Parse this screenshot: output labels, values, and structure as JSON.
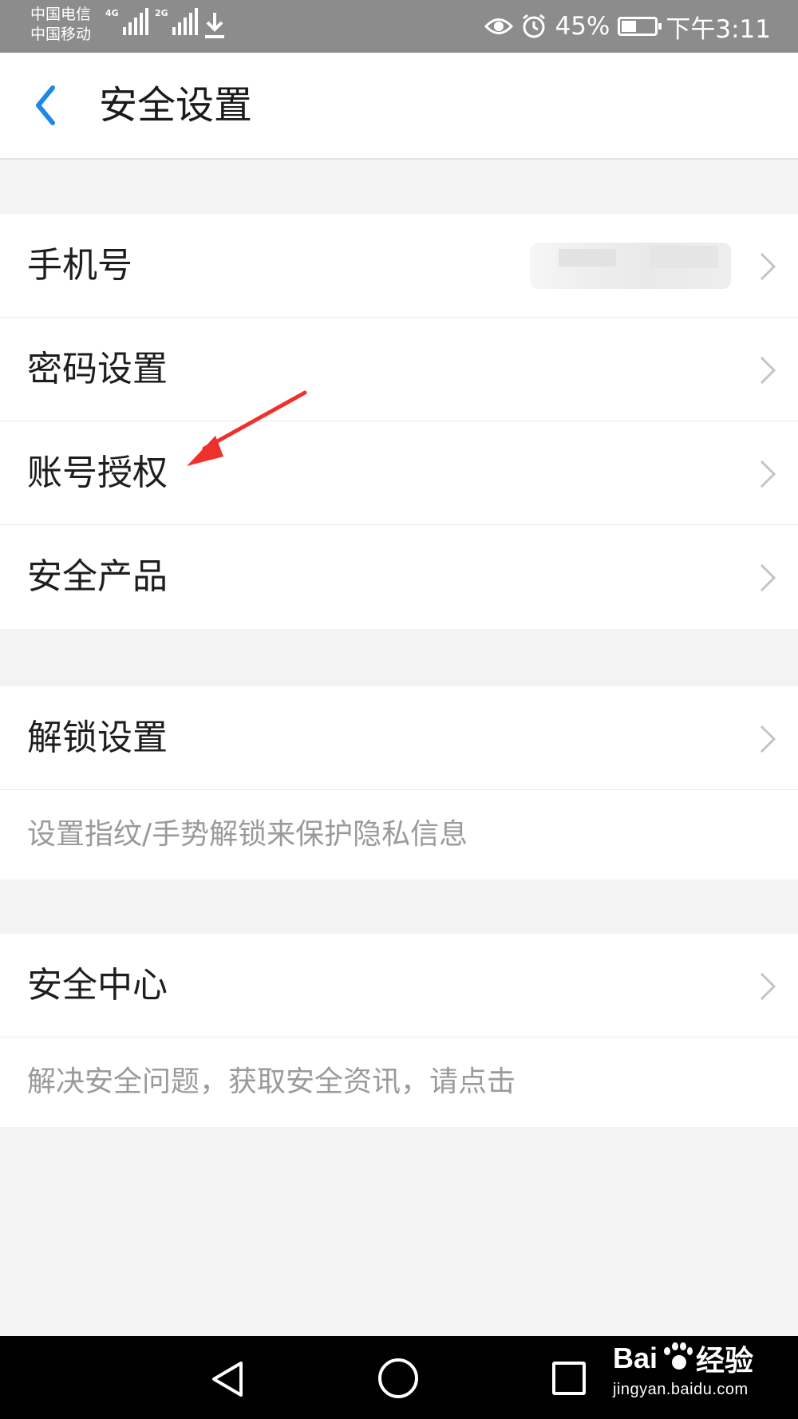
{
  "status_bar": {
    "carrier_1": "中国电信",
    "carrier_2": "中国移动",
    "net_1": "4G",
    "net_2": "2G",
    "battery_percent": "45%",
    "battery_level": 0.45,
    "time": "下午3:11",
    "icons": [
      "eye-icon",
      "alarm-icon",
      "battery-icon",
      "download-icon"
    ]
  },
  "header": {
    "back_icon": "chevron-left-icon",
    "title": "安全设置",
    "accent_color": "#1e88e5"
  },
  "group_1": {
    "items": [
      {
        "label": "手机号",
        "value_redacted": true
      },
      {
        "label": "密码设置"
      },
      {
        "label": "账号授权"
      },
      {
        "label": "安全产品"
      }
    ]
  },
  "group_2": {
    "label": "解锁设置",
    "description": "设置指纹/手势解锁来保护隐私信息"
  },
  "group_3": {
    "label": "安全中心",
    "description": "解决安全问题，获取安全资讯，请点击"
  },
  "annotation": {
    "type": "red-arrow",
    "points_to": "账号授权",
    "color": "#f0302a"
  },
  "nav_bar": {
    "icons": [
      "back-triangle-icon",
      "home-circle-icon",
      "recent-square-icon"
    ]
  },
  "watermark": {
    "brand_prefix": "Bai",
    "brand_suffix": "经验",
    "url": "jingyan.baidu.com"
  }
}
